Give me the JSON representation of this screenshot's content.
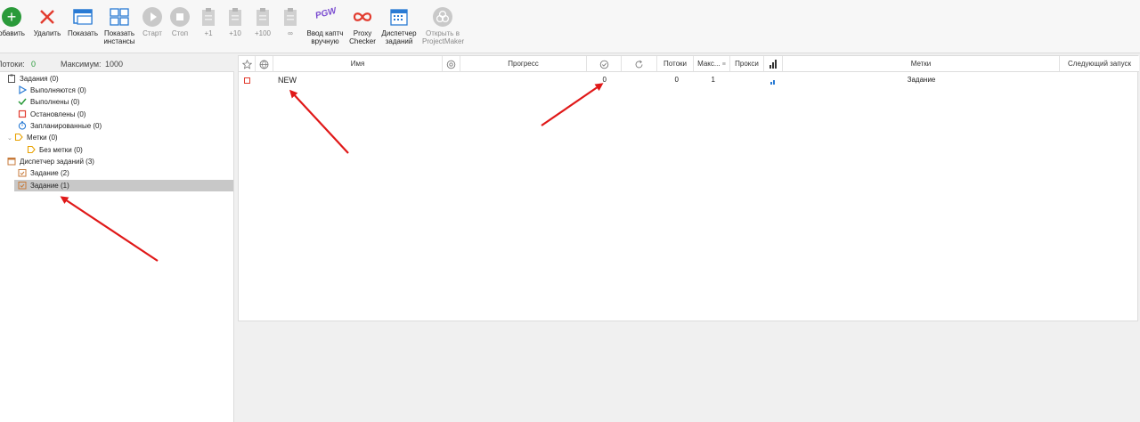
{
  "toolbar": {
    "buttons": [
      {
        "label": "обавить",
        "icon": "add-icon"
      },
      {
        "label": "Удалить",
        "icon": "delete-icon"
      },
      {
        "label": "Показать",
        "icon": "show-icon"
      },
      {
        "label": "Показать инстансы",
        "icon": "show-instances-icon"
      },
      {
        "label": "Старт",
        "icon": "play-icon"
      },
      {
        "label": "Стоп",
        "icon": "stop-icon"
      },
      {
        "label": "+1",
        "icon": "clipboard-icon"
      },
      {
        "label": "+10",
        "icon": "clipboard-icon"
      },
      {
        "label": "+100",
        "icon": "clipboard-icon"
      },
      {
        "label": "∞",
        "icon": "clipboard-icon"
      },
      {
        "label": "Ввод каптч вручную",
        "icon": "captcha-icon"
      },
      {
        "label": "Proxy Checker",
        "icon": "infinity-icon"
      },
      {
        "label": "Диспетчер заданий",
        "icon": "calendar-icon"
      },
      {
        "label": "Открыть в ProjectMaker",
        "icon": "projectmaker-icon"
      }
    ],
    "captcha_glyph": "PGW"
  },
  "status": {
    "threads_label": "Потоки:",
    "threads_value": "0",
    "max_label": "Максимум:",
    "max_value": "1000"
  },
  "tree": {
    "tasks": "Задания (0)",
    "running": "Выполняются (0)",
    "done": "Выполнены (0)",
    "stopped": "Остановлены (0)",
    "scheduled": "Запланированные (0)",
    "labels": "Метки (0)",
    "no_label": "Без метки (0)",
    "dispatcher": "Диспетчер заданий (3)",
    "task2": "Задание (2)",
    "task1": "Задание (1)"
  },
  "grid": {
    "columns": {
      "name": "Имя",
      "progress": "Прогресс",
      "threads": "Потоки",
      "max": "Макс...",
      "proxy": "Прокси",
      "labels": "Метки",
      "next_run": "Следующий запуск"
    },
    "rows": [
      {
        "name": "NEW",
        "success": "0",
        "threads": "0",
        "max": "1",
        "labels": "Задание"
      }
    ]
  },
  "colors": {
    "accent_green": "#2a9a3a",
    "delete_red": "#e23b2e",
    "annotation_red": "#e01818",
    "blue": "#2a7bd4"
  }
}
